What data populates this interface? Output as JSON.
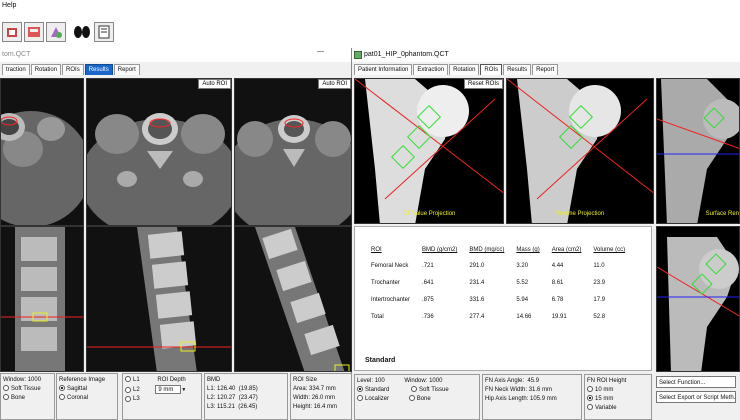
{
  "menubar": {
    "help": "Help"
  },
  "toolbar": {
    "icons": [
      "open-icon",
      "save-icon",
      "tools-icon",
      "lungs-icon",
      "report-icon"
    ]
  },
  "spine_window": {
    "title": "tom.QCT",
    "tabs": [
      "traction",
      "Rotation",
      "ROIs",
      "Results",
      "Report"
    ],
    "active_tab": "Results",
    "auto_roi_1": "Auto ROI",
    "auto_roi_2": "Auto ROI",
    "controls": {
      "window_label": "Window:",
      "window_value": "1000",
      "soft_tissue": "Soft Tissue",
      "bone": "Bone",
      "ref_image_title": "Reference Image",
      "sagittal": "Sagittal",
      "coronal": "Coronal",
      "l1": "L1",
      "l2": "L2",
      "l3": "L3",
      "roi_depth": "ROI Depth",
      "roi_depth_value": "9 mm",
      "bmd_title": "BMD",
      "bmd_rows": [
        {
          "level": "L1:",
          "value": "126.40",
          "sd": "(19.85)"
        },
        {
          "level": "L2:",
          "value": "120.27",
          "sd": "(23.47)"
        },
        {
          "level": "L3:",
          "value": "115.21",
          "sd": "(26.45)"
        }
      ],
      "roi_size_title": "ROI Size",
      "roi_size_rows": [
        {
          "label": "Area:",
          "value": "334.7 mm"
        },
        {
          "label": "Width:",
          "value": "26.0 mm"
        },
        {
          "label": "Height:",
          "value": "16.4 mm"
        }
      ]
    }
  },
  "hip_window": {
    "title": "pat01_HIP_0phantom.QCT",
    "tabs": [
      "Patient Information",
      "Extraction",
      "Rotation",
      "ROIs",
      "Results",
      "Report"
    ],
    "selected_tab": "ROIs",
    "reset_rois": "Reset ROIs",
    "panel_labels": [
      "CT Value Projection",
      "Volume Projection",
      "Surface Ren"
    ],
    "table": {
      "headers": [
        "ROI",
        "BMD (g/cm2)",
        "BMD (mg/cc)",
        "Mass (g)",
        "Area (cm2)",
        "Volume (cc)"
      ],
      "rows": [
        [
          "Femoral Neck",
          ".721",
          "291.0",
          "3.20",
          "4.44",
          "11.0"
        ],
        [
          "Trochanter",
          ".641",
          "231.4",
          "5.52",
          "8.61",
          "23.9"
        ],
        [
          "Intertrochanter",
          ".875",
          "331.6",
          "5.94",
          "6.78",
          "17.9"
        ],
        [
          "Total",
          ".736",
          "277.4",
          "14.66",
          "19.91",
          "52.8"
        ]
      ],
      "footer": "Standard"
    },
    "controls": {
      "level_label": "Level:",
      "level_value": "100",
      "window_label": "Window:",
      "window_value": "1000",
      "standard": "Standard",
      "soft_tissue": "Soft Tissue",
      "localizer": "Localizer",
      "bone": "Bone",
      "fn_axis_angle_label": "FN Axis Angle:",
      "fn_axis_angle": "45.9",
      "fn_neck_width_label": "FN Neck Width:",
      "fn_neck_width": "31.6 mm",
      "hip_axis_length_label": "Hip Axis Length:",
      "hip_axis_length": "105.9 mm",
      "fn_roi_height": "FN ROI Height",
      "h10": "10 mm",
      "h15": "15 mm",
      "variable": "Variable",
      "select_function": "Select Function...",
      "select_export": "Select Export or Script Meth..."
    }
  }
}
